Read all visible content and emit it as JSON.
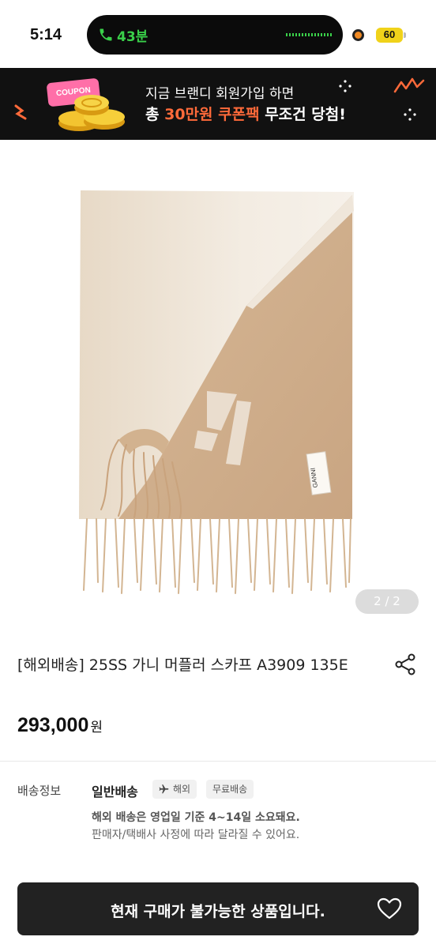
{
  "status_bar": {
    "time": "5:14",
    "call_duration": "43분",
    "battery": "60"
  },
  "banner": {
    "coupon_tag": "COUPON",
    "line1": "지금 브랜디 회원가입 하면",
    "line2_prefix": "총 ",
    "line2_highlight": "30만원 쿠폰팩",
    "line2_suffix": " 무조건 당첨!",
    "highlight_color": "#ff6a3a"
  },
  "product": {
    "image_alt_brand_label": "GANNI",
    "page_indicator": "2 / 2",
    "title": "[해외배송] 25SS 가니 머플러 스카프 A3909 135E",
    "price": "293,000",
    "price_unit": "원"
  },
  "shipping": {
    "label": "배송정보",
    "type": "일반배송",
    "badge_overseas": "해외",
    "badge_free": "무료배송",
    "desc1": "해외 배송은 영업일 기준 4~14일 소요돼요.",
    "desc2": "판매자/택배사 사정에 따라 달라질 수 있어요."
  },
  "bottom_bar": {
    "buy_label": "현재 구매가 불가능한 상품입니다."
  },
  "icons": [
    "call-icon",
    "coupon-coins-icon",
    "share-icon",
    "airplane-icon",
    "heart-icon"
  ]
}
